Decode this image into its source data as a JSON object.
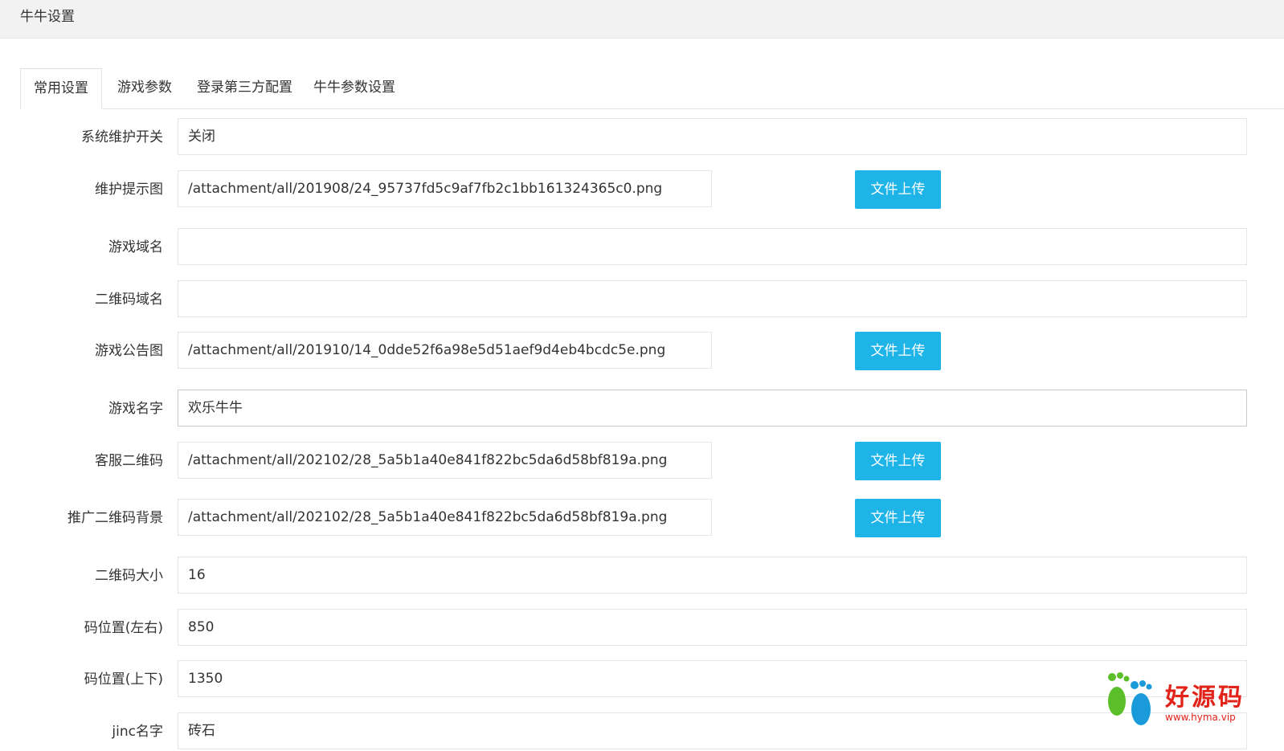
{
  "header": {
    "title": "牛牛设置"
  },
  "tabs": [
    {
      "label": "常用设置",
      "active": true
    },
    {
      "label": "游戏参数",
      "active": false
    },
    {
      "label": "登录第三方配置",
      "active": false
    },
    {
      "label": "牛牛参数设置",
      "active": false
    }
  ],
  "form": {
    "upload_label": "文件上传",
    "rows": [
      {
        "label": "系统维护开关",
        "value": "关闭"
      },
      {
        "label": "维护提示图",
        "value": "/attachment/all/201908/24_95737fd5c9af7fb2c1bb161324365c0.png"
      },
      {
        "label": "游戏域名",
        "value": ""
      },
      {
        "label": "二维码域名",
        "value": ""
      },
      {
        "label": "游戏公告图",
        "value": "/attachment/all/201910/14_0dde52f6a98e5d51aef9d4eb4bcdc5e.png"
      },
      {
        "label": "游戏名字",
        "value": "欢乐牛牛"
      },
      {
        "label": "客服二维码",
        "value": "/attachment/all/202102/28_5a5b1a40e841f822bc5da6d58bf819a.png"
      },
      {
        "label": "推广二维码背景",
        "value": "/attachment/all/202102/28_5a5b1a40e841f822bc5da6d58bf819a.png"
      },
      {
        "label": "二维码大小",
        "value": "16"
      },
      {
        "label": "码位置(左右)",
        "value": "850"
      },
      {
        "label": "码位置(上下)",
        "value": "1350"
      },
      {
        "label": "jinc名字",
        "value": "砖石"
      }
    ]
  },
  "watermark": {
    "text": "好源码",
    "url": "www.hyma.vip"
  },
  "colors": {
    "accent": "#1eb4e8",
    "watermark": "#e2231a"
  }
}
